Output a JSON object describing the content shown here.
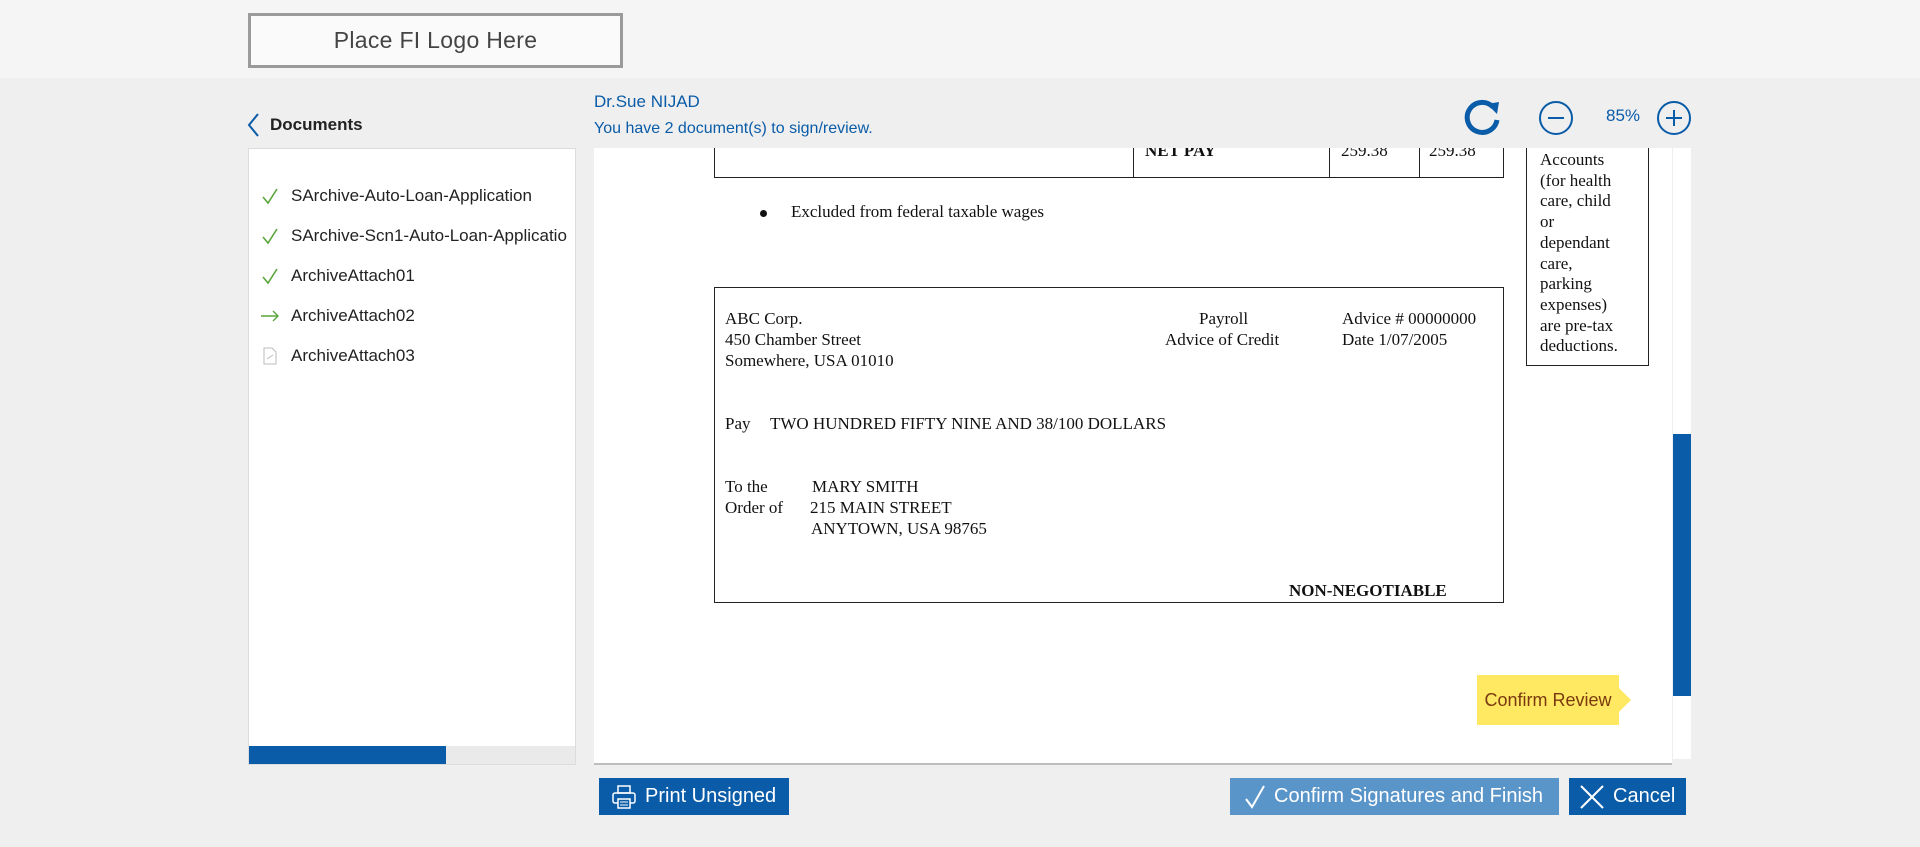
{
  "header": {
    "logo_text": "Place FI Logo Here"
  },
  "nav": {
    "back_label": "Documents"
  },
  "user": {
    "name": "Dr.Sue NIJAD",
    "doc_count_text": "You have 2 document(s) to sign/review."
  },
  "viewer_controls": {
    "zoom_level": "85%"
  },
  "sidebar": {
    "items": [
      {
        "label": "SArchive-Auto-Loan-Application",
        "status": "signed"
      },
      {
        "label": "SArchive-Scn1-Auto-Loan-Applicatio",
        "status": "signed"
      },
      {
        "label": "ArchiveAttach01",
        "status": "signed"
      },
      {
        "label": "ArchiveAttach02",
        "status": "current"
      },
      {
        "label": "ArchiveAttach03",
        "status": "pending"
      }
    ],
    "progress_fraction": 0.6
  },
  "document": {
    "table_row": {
      "label": "NET PAY",
      "current": "259.38",
      "ytd": "259.38"
    },
    "bullet_text": "Excluded from federal taxable wages",
    "side_note_lines": [
      "Accounts",
      "(for health",
      "care, child",
      "or",
      "dependant",
      "care,",
      "parking",
      "expenses)",
      "are pre-tax",
      "deductions."
    ],
    "check": {
      "company_line1": "ABC Corp.",
      "company_line2": "450 Chamber Street",
      "company_line3": "Somewhere, USA 01010",
      "payroll_line1": "Payroll",
      "payroll_line2": "Advice of Credit",
      "advice_no": "Advice # 00000000",
      "date": "Date 1/07/2005",
      "pay_label": "Pay",
      "pay_amount": "TWO HUNDRED FIFTY NINE AND 38/100 DOLLARS",
      "to_the": "To the",
      "order_of": "Order of",
      "payee_name": "MARY SMITH",
      "payee_street": "215 MAIN STREET",
      "payee_city": "ANYTOWN, USA   98765",
      "non_negotiable": "NON-NEGOTIABLE"
    }
  },
  "confirm_review_label": "Confirm Review",
  "scroll_fraction": 0.82,
  "footer": {
    "print_label": "Print Unsigned",
    "confirm_label": "Confirm Signatures and Finish",
    "cancel_label": "Cancel"
  },
  "colors": {
    "accent": "#0a5ca8",
    "confirm_disabled": "#5a95c9",
    "review_tag": "#ffe862",
    "signed_check": "#5aa53a"
  }
}
